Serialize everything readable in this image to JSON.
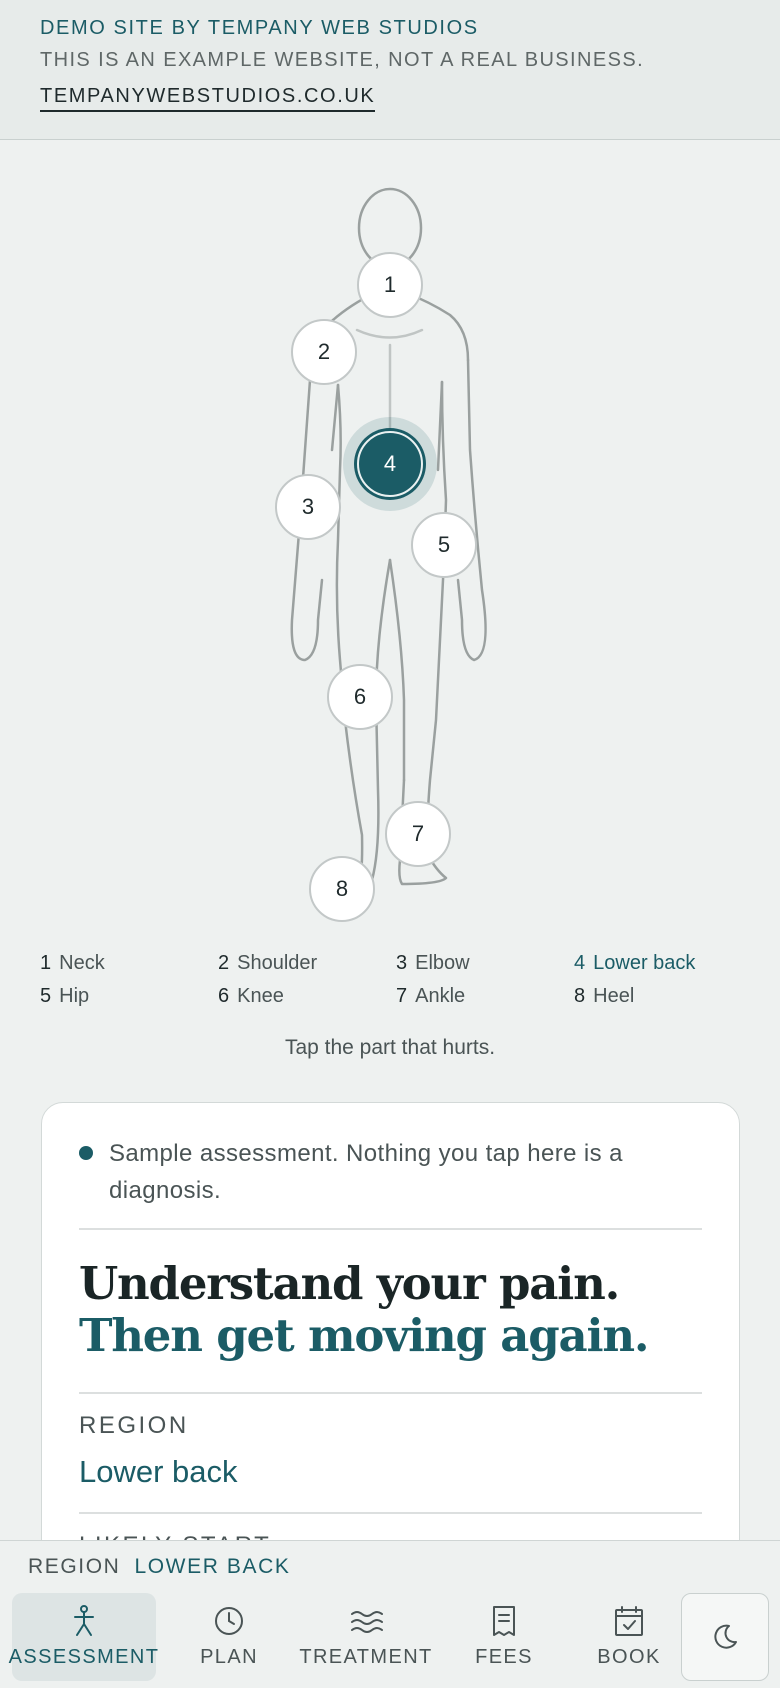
{
  "banner": {
    "title": "DEMO SITE BY TEMPANY WEB STUDIOS",
    "subtitle": "THIS IS AN EXAMPLE WEBSITE, NOT A REAL BUSINESS.",
    "link": "TEMPANYWEBSTUDIOS.CO.UK"
  },
  "body_map": {
    "pins": [
      "1",
      "2",
      "3",
      "4",
      "5",
      "6",
      "7",
      "8"
    ],
    "selected": "4"
  },
  "legend": [
    {
      "num": "1",
      "label": "Neck"
    },
    {
      "num": "2",
      "label": "Shoulder"
    },
    {
      "num": "3",
      "label": "Elbow"
    },
    {
      "num": "4",
      "label": "Lower back"
    },
    {
      "num": "5",
      "label": "Hip"
    },
    {
      "num": "6",
      "label": "Knee"
    },
    {
      "num": "7",
      "label": "Ankle"
    },
    {
      "num": "8",
      "label": "Heel"
    }
  ],
  "hint": "Tap the part that hurts.",
  "card": {
    "notice": "Sample assessment. Nothing you tap here is a diagnosis.",
    "headline_line1": "Understand your pain.",
    "headline_line2": "Then get moving again.",
    "region_label": "REGION",
    "region_value": "Lower back",
    "next_label": "LIKELY START"
  },
  "bottom_bar": {
    "summary_label": "REGION",
    "summary_value": "LOWER BACK",
    "tabs": [
      {
        "label": "ASSESSMENT",
        "icon": "person-icon",
        "active": true
      },
      {
        "label": "PLAN",
        "icon": "clock-icon",
        "active": false
      },
      {
        "label": "TREATMENT",
        "icon": "waves-icon",
        "active": false
      },
      {
        "label": "FEES",
        "icon": "receipt-icon",
        "active": false
      },
      {
        "label": "BOOK",
        "icon": "calendar-check-icon",
        "active": false
      }
    ],
    "theme_toggle_icon": "moon-icon"
  },
  "colors": {
    "accent": "#1b5c66",
    "background": "#eef1f0",
    "text": "#1f2a2c"
  }
}
